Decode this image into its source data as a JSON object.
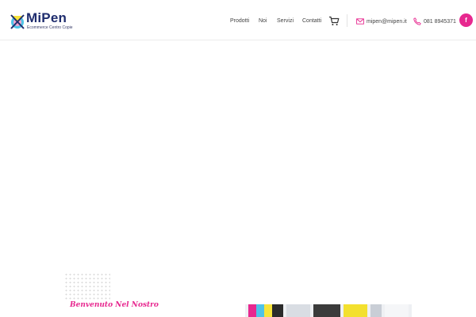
{
  "brand": {
    "name": "MiPen",
    "tagline": "Ecommerce Centro Copie"
  },
  "nav": {
    "items": [
      "Prodotti",
      "Noi",
      "Servizi",
      "Contatti"
    ]
  },
  "contact": {
    "email": "mipen@mipen.it",
    "phone": "081 8945371"
  },
  "social": {
    "facebook_label": "f"
  },
  "hero": {
    "heading": "Benvenuto Nel Nostro"
  },
  "colors": {
    "accent": "#e7288f",
    "brand_blue": "#1f2d6e"
  },
  "icons": {
    "cart": "cart-icon",
    "email": "envelope-icon",
    "phone": "phone-icon",
    "facebook": "facebook-icon"
  }
}
